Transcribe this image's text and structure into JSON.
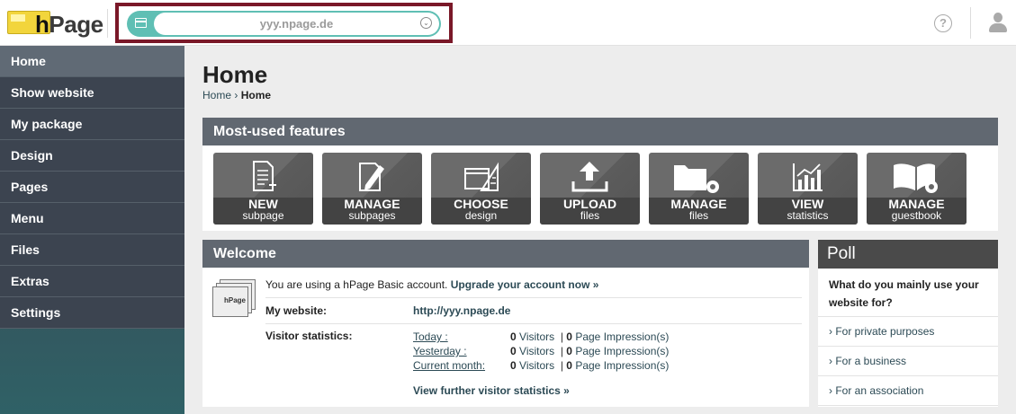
{
  "logo": {
    "prefix": "h",
    "name": "Page"
  },
  "url_bar": {
    "value": "yyy.npage.de"
  },
  "header": {
    "help_glyph": "?"
  },
  "sidebar": {
    "items": [
      {
        "label": "Home",
        "active": true
      },
      {
        "label": "Show website"
      },
      {
        "label": "My package"
      },
      {
        "label": "Design"
      },
      {
        "label": "Pages"
      },
      {
        "label": "Menu"
      },
      {
        "label": "Files"
      },
      {
        "label": "Extras"
      },
      {
        "label": "Settings"
      }
    ]
  },
  "main": {
    "title": "Home",
    "breadcrumb": {
      "root": "Home",
      "sep": "›",
      "current": "Home"
    }
  },
  "features": {
    "heading": "Most-used features",
    "tiles": [
      {
        "line1": "NEW",
        "line2": "subpage",
        "icon": "new-page-icon"
      },
      {
        "line1": "MANAGE",
        "line2": "subpages",
        "icon": "edit-page-icon"
      },
      {
        "line1": "CHOOSE",
        "line2": "design",
        "icon": "design-icon"
      },
      {
        "line1": "UPLOAD",
        "line2": "files",
        "icon": "upload-icon"
      },
      {
        "line1": "MANAGE",
        "line2": "files",
        "icon": "folder-gear-icon"
      },
      {
        "line1": "VIEW",
        "line2": "statistics",
        "icon": "chart-icon"
      },
      {
        "line1": "MANAGE",
        "line2": "guestbook",
        "icon": "book-gear-icon"
      }
    ]
  },
  "welcome": {
    "heading": "Welcome",
    "icon_label": "hPage",
    "account_text": "You are using a hPage Basic account.",
    "upgrade_link": "Upgrade your account now »",
    "website_label": "My website:",
    "website_url": "http://yyy.npage.de",
    "stats_label": "Visitor statistics:",
    "stats": [
      {
        "period": "Today :",
        "visitors": "0",
        "visitors_label": "Visitors",
        "sep": "|",
        "impressions": "0",
        "impressions_label": "Page Impression(s)"
      },
      {
        "period": "Yesterday :",
        "visitors": "0",
        "visitors_label": "Visitors",
        "sep": "|",
        "impressions": "0",
        "impressions_label": "Page Impression(s)"
      },
      {
        "period": "Current month:",
        "visitors": "0",
        "visitors_label": "Visitors",
        "sep": "|",
        "impressions": "0",
        "impressions_label": "Page Impression(s)"
      }
    ],
    "more_stats_link": "View further visitor statistics »"
  },
  "poll": {
    "heading": "Poll",
    "question": "What do you mainly use your website for?",
    "options": [
      "› For private purposes",
      "› For a business",
      "› For an association"
    ]
  },
  "colors": {
    "accent_teal": "#5fbfb4",
    "highlight_border": "#7a1828",
    "sidebar": "#3c4450",
    "panel_head": "#616871"
  }
}
